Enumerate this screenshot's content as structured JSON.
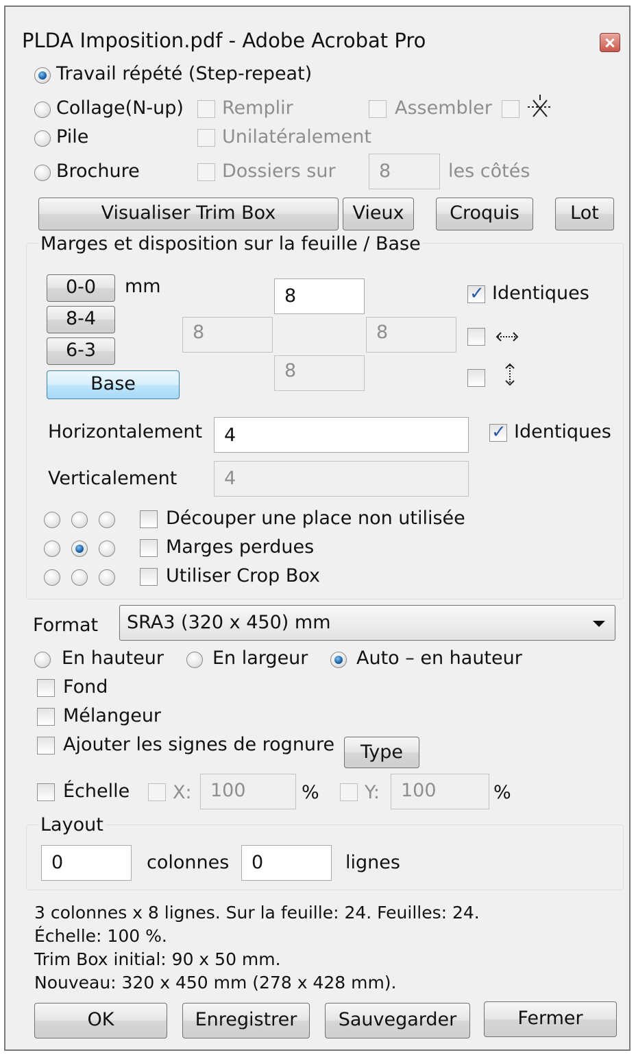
{
  "window": {
    "title": "PLDA Imposition.pdf - Adobe Acrobat Pro"
  },
  "mode": {
    "step_repeat": "Travail répété (Step-repeat)",
    "nup": "Collage(N-up)",
    "pile": "Pile",
    "brochure": "Brochure",
    "remplir": "Remplir",
    "assembler": "Assembler",
    "unilateral": "Unilatéralement",
    "dossiers": "Dossiers sur",
    "dossiers_value": "8",
    "les_cotes": "les côtés",
    "selected": "step_repeat"
  },
  "toolbar": {
    "trim_box": "Visualiser Trim Box",
    "vieux": "Vieux",
    "croquis": "Croquis",
    "lot": "Lot"
  },
  "margins": {
    "group_label": "Marges et disposition sur la feuille / Base",
    "preset_00": "0-0",
    "preset_84": "8-4",
    "preset_63": "6-3",
    "base": "Base",
    "unit": "mm",
    "top": "8",
    "left": "8",
    "right": "8",
    "bottom": "8",
    "identiques": "Identiques",
    "horiz_label": "Horizontalement",
    "horiz_value": "4",
    "vert_label": "Verticalement",
    "vert_value": "4",
    "identiques2": "Identiques",
    "decouper": "Découper une place non utilisée",
    "marges_perdues": "Marges perdues",
    "crop_box": "Utiliser Crop Box",
    "anchor_selected": "center"
  },
  "format": {
    "label": "Format",
    "value": "SRA3 (320 x 450) mm",
    "portrait": "En hauteur",
    "landscape": "En largeur",
    "auto": "Auto – en hauteur",
    "orientation_selected": "auto",
    "fond": "Fond",
    "melangeur": "Mélangeur",
    "rognure": "Ajouter les signes de rognure",
    "type_button": "Type",
    "echelle": "Échelle",
    "x_label": "X:",
    "x_value": "100",
    "y_label": "Y:",
    "y_value": "100",
    "percent": "%"
  },
  "layout": {
    "group_label": "Layout",
    "columns_value": "0",
    "columns_label": "colonnes",
    "rows_value": "0",
    "rows_label": "lignes"
  },
  "summary": {
    "line1": "3 colonnes x 8 lignes. Sur la feuille: 24. Feuilles: 24.",
    "line2": "Échelle: 100 %.",
    "line3": "Trim Box initial: 90 x 50 mm.",
    "line4": "Nouveau: 320 x 450 mm (278 x 428 mm)."
  },
  "footer": {
    "ok": "OK",
    "enregistrer": "Enregistrer",
    "sauvegarder": "Sauvegarder",
    "fermer": "Fermer"
  }
}
